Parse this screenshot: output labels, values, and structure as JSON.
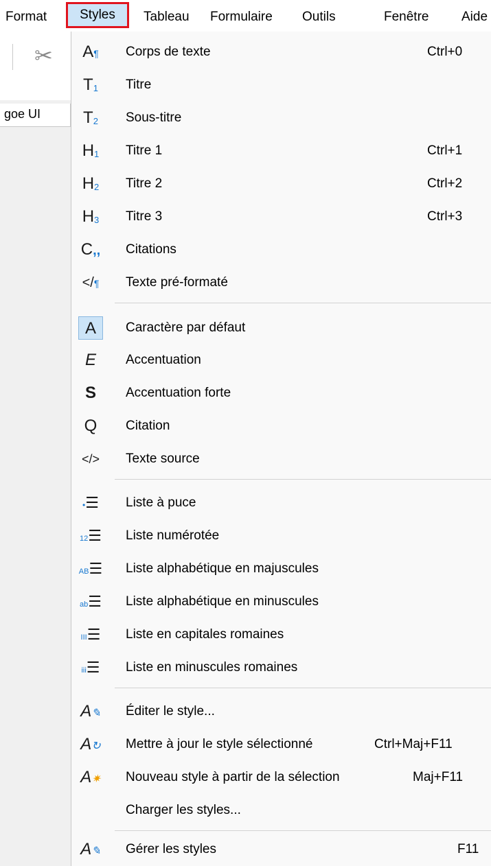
{
  "menubar": {
    "items": [
      "Format",
      "Styles",
      "Tableau",
      "Formulaire",
      "Outils",
      "Fenêtre",
      "Aide"
    ],
    "active": "Styles"
  },
  "toolbar": {
    "font_name": "goe UI"
  },
  "styles_menu": {
    "paragraph_styles": [
      {
        "label": "Corps de texte",
        "shortcut": "Ctrl+0",
        "icon": "body-text-icon"
      },
      {
        "label": "Titre",
        "shortcut": "",
        "icon": "title-icon"
      },
      {
        "label": "Sous-titre",
        "shortcut": "",
        "icon": "subtitle-icon"
      },
      {
        "label": "Titre 1",
        "shortcut": "Ctrl+1",
        "icon": "heading1-icon"
      },
      {
        "label": "Titre 2",
        "shortcut": "Ctrl+2",
        "icon": "heading2-icon"
      },
      {
        "label": "Titre 3",
        "shortcut": "Ctrl+3",
        "icon": "heading3-icon"
      },
      {
        "label": "Citations",
        "shortcut": "",
        "icon": "quotations-icon"
      },
      {
        "label": "Texte pré-formaté",
        "shortcut": "",
        "icon": "preformatted-icon"
      }
    ],
    "character_styles": [
      {
        "label": "Caractère par défaut",
        "icon": "default-char-icon"
      },
      {
        "label": "Accentuation",
        "icon": "emphasis-icon"
      },
      {
        "label": "Accentuation forte",
        "icon": "strong-emphasis-icon"
      },
      {
        "label": "Citation",
        "icon": "quotation-icon"
      },
      {
        "label": "Texte source",
        "icon": "source-text-icon"
      }
    ],
    "list_styles": [
      {
        "label": "Liste à puce",
        "icon": "bullet-list-icon"
      },
      {
        "label": "Liste numérotée",
        "icon": "numbered-list-icon"
      },
      {
        "label": "Liste alphabétique en majuscules",
        "icon": "alpha-upper-list-icon"
      },
      {
        "label": "Liste alphabétique en minuscules",
        "icon": "alpha-lower-list-icon"
      },
      {
        "label": "Liste en capitales romaines",
        "icon": "roman-upper-list-icon"
      },
      {
        "label": "Liste en minuscules romaines",
        "icon": "roman-lower-list-icon"
      }
    ],
    "style_actions": [
      {
        "label": "Éditer le style...",
        "shortcut": "",
        "icon": "edit-style-icon"
      },
      {
        "label": "Mettre à jour le style sélectionné",
        "shortcut": "Ctrl+Maj+F11",
        "icon": "update-style-icon"
      },
      {
        "label": "Nouveau style à partir de la sélection",
        "shortcut": "Maj+F11",
        "icon": "new-style-icon"
      },
      {
        "label": "Charger les styles...",
        "shortcut": "",
        "icon": ""
      }
    ],
    "manage": {
      "label": "Gérer les styles",
      "shortcut": "F11",
      "icon": "manage-styles-icon"
    }
  },
  "colors": {
    "highlight": "#cce4f7",
    "active_border": "#e0141e",
    "icon_accent": "#1878d0"
  }
}
